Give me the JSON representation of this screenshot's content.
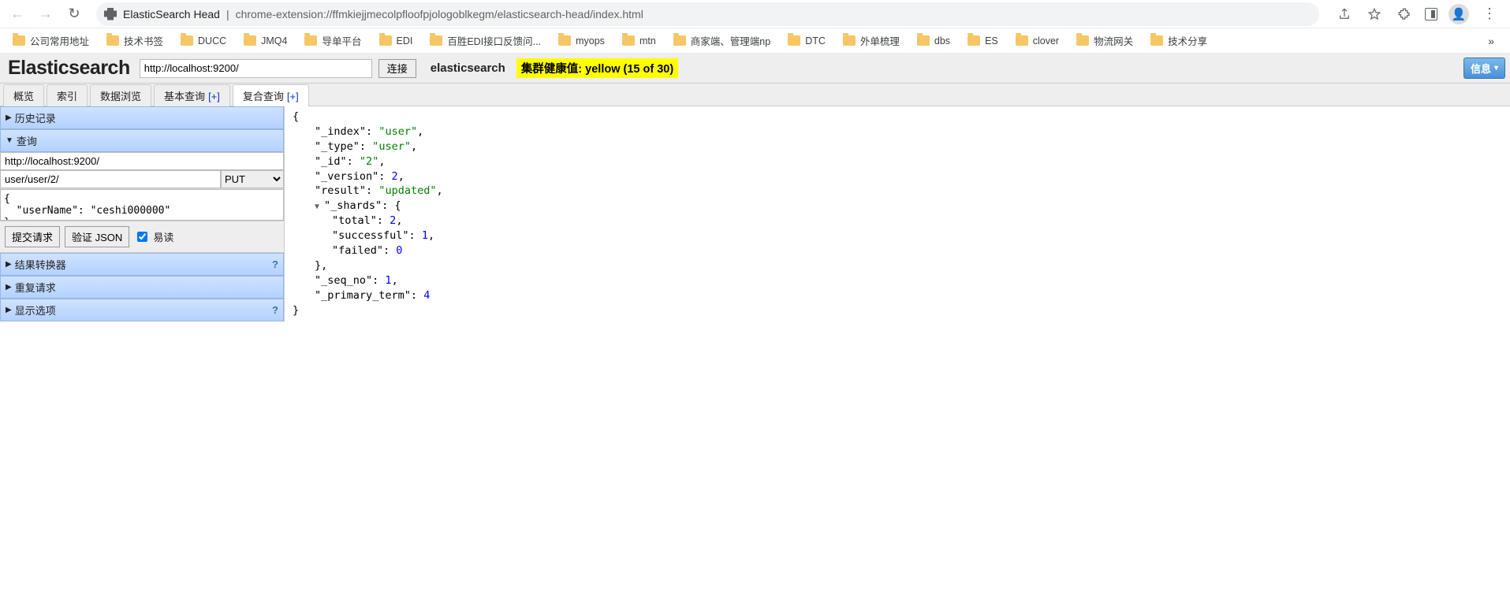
{
  "chrome": {
    "title": "ElasticSearch Head",
    "url": "chrome-extension://ffmkiejjmecolpfloofpjologoblkegm/elasticsearch-head/index.html",
    "bookmarks": [
      "公司常用地址",
      "技术书签",
      "DUCC",
      "JMQ4",
      "导单平台",
      "EDI",
      "百胜EDI接口反馈问...",
      "myops",
      "mtn",
      "商家端、管理端np",
      "DTC",
      "外单梳理",
      "dbs",
      "ES",
      "clover",
      "物流网关",
      "技术分享"
    ],
    "more_bookmarks": "»"
  },
  "header": {
    "logo": "Elasticsearch",
    "url_input": "http://localhost:9200/",
    "connect": "连接",
    "cluster_name": "elasticsearch",
    "health": "集群健康值: yellow (15 of 30)",
    "info_btn": "信息"
  },
  "tabs": {
    "overview": "概览",
    "indices": "索引",
    "browse": "数据浏览",
    "basic": "基本查询",
    "basic_plus": "[+]",
    "compound": "复合查询",
    "compound_plus": "[+]"
  },
  "side": {
    "history_head": "历史记录",
    "query_head": "查询",
    "url": "http://localhost:9200/",
    "path": "user/user/2/",
    "method": "PUT",
    "body": "{\n  \"userName\": \"ceshi000000\"\n}",
    "submit": "提交请求",
    "validate": "验证 JSON",
    "pretty": "易读",
    "result_transformer": "结果转换器",
    "repeat_request": "重复请求",
    "display_options": "显示选项",
    "qmark": "?"
  },
  "result": {
    "index": "user",
    "type": "user",
    "id": "2",
    "version": 2,
    "result": "updated",
    "shards_total": 2,
    "shards_successful": 1,
    "shards_failed": 0,
    "seq_no": 1,
    "primary_term": 4
  }
}
